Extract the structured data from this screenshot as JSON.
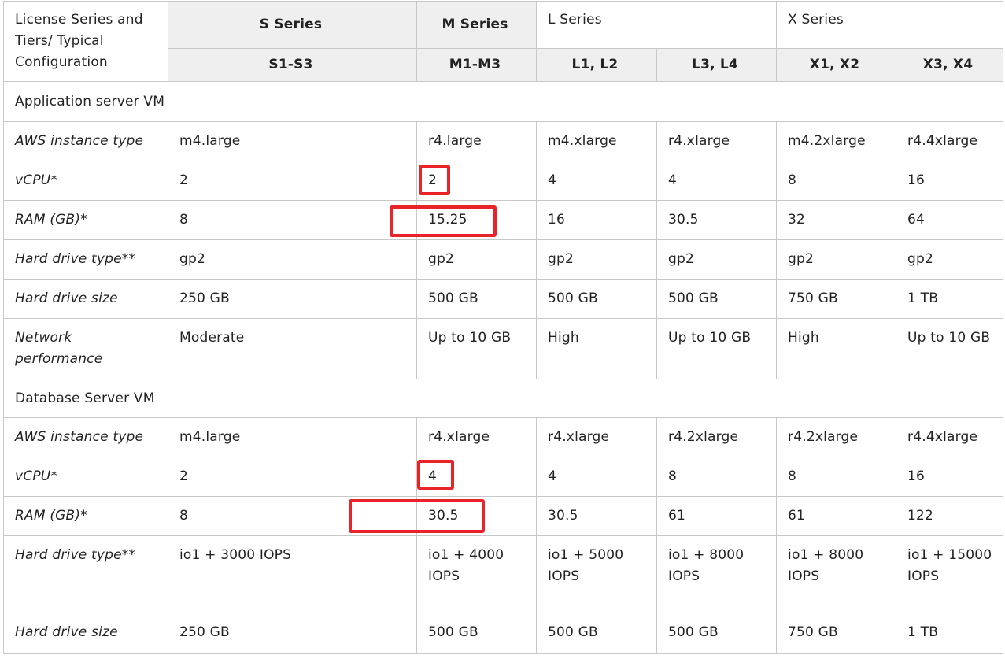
{
  "header": {
    "corner": "License Series and Tiers/ Typical Configuration",
    "series": [
      "S Series",
      "M Series",
      "L Series",
      "X Series"
    ],
    "tiers": [
      "S1-S3",
      "M1-M3",
      "L1, L2",
      "L3, L4",
      "X1, X2",
      "X3, X4"
    ]
  },
  "sections": [
    {
      "title": "Application server VM",
      "rows": [
        {
          "label": "AWS instance type",
          "cells": [
            "m4.large",
            "r4.large",
            "m4.xlarge",
            "r4.xlarge",
            "m4.2xlarge",
            "r4.4xlarge"
          ]
        },
        {
          "label": "vCPU*",
          "cells": [
            "2",
            "2",
            "4",
            "4",
            "8",
            "16"
          ]
        },
        {
          "label": "RAM (GB)*",
          "cells": [
            "8",
            "15.25",
            "16",
            "30.5",
            "32",
            "64"
          ]
        },
        {
          "label": "Hard drive type**",
          "cells": [
            "gp2",
            "gp2",
            "gp2",
            "gp2",
            "gp2",
            "gp2"
          ]
        },
        {
          "label": "Hard drive size",
          "cells": [
            "250 GB",
            "500 GB",
            "500 GB",
            "500 GB",
            "750 GB",
            "1 TB"
          ]
        },
        {
          "label": "Network performance",
          "cells": [
            "Moderate",
            "Up to 10 GB",
            "High",
            "Up to 10 GB",
            "High",
            "Up to 10 GB"
          ]
        }
      ]
    },
    {
      "title": "Database Server VM",
      "rows": [
        {
          "label": "AWS instance type",
          "cells": [
            "m4.large",
            "r4.xlarge",
            "r4.xlarge",
            "r4.2xlarge",
            "r4.2xlarge",
            "r4.4xlarge"
          ]
        },
        {
          "label": "vCPU*",
          "cells": [
            "2",
            "4",
            "4",
            "8",
            "8",
            "16"
          ]
        },
        {
          "label": "RAM (GB)*",
          "cells": [
            "8",
            "30.5",
            "30.5",
            "61",
            "61",
            "122"
          ]
        },
        {
          "label": "Hard drive type**",
          "cells": [
            "io1 + 3000 IOPS",
            "io1 + 4000 IOPS",
            "io1 + 5000 IOPS",
            "io1 + 8000 IOPS",
            "io1 + 8000 IOPS",
            "io1 + 15000 IOPS"
          ]
        },
        {
          "label": "Hard drive size",
          "cells": [
            "250 GB",
            "500 GB",
            "500 GB",
            "500 GB",
            "750 GB",
            "1 TB"
          ]
        }
      ]
    }
  ],
  "colors": {
    "highlight": "#e8232a",
    "header_bg": "#efefef",
    "border": "#c8c8c8"
  }
}
